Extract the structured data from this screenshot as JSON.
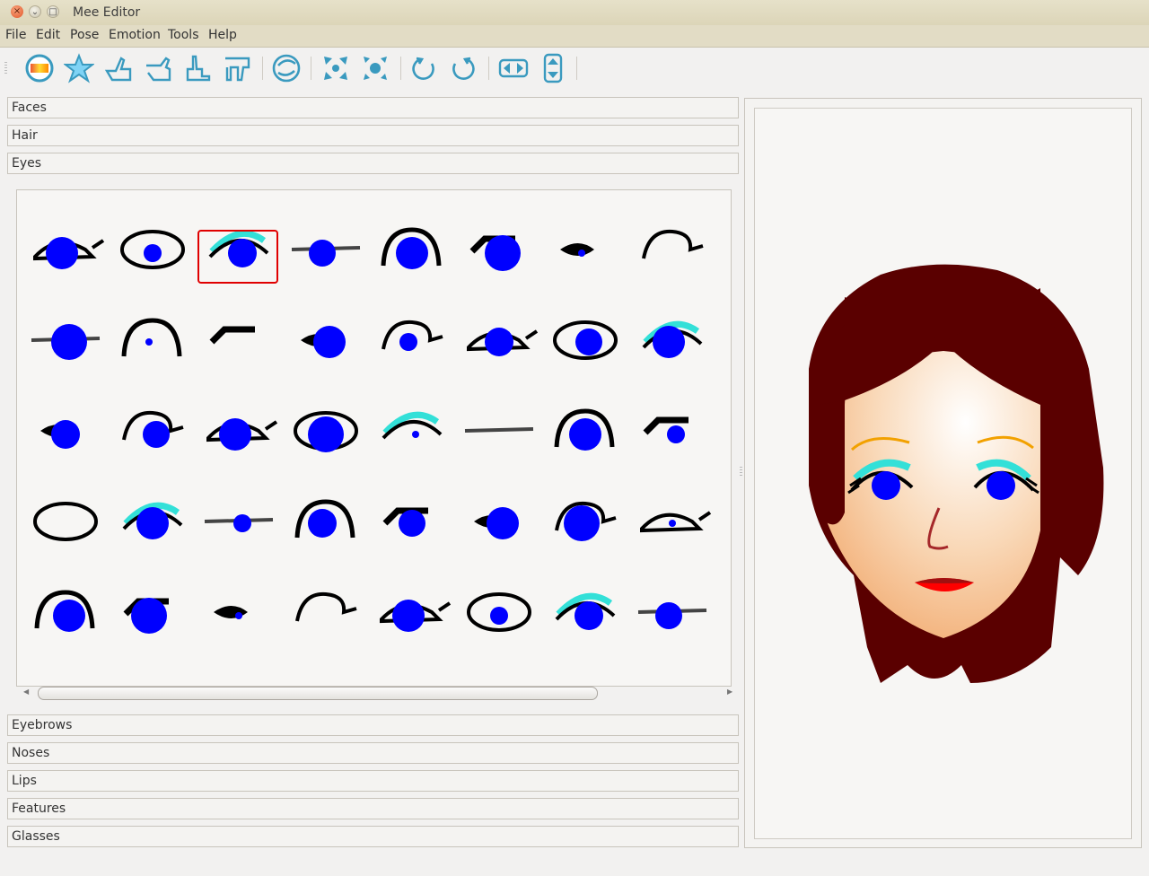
{
  "window": {
    "title": "Mee Editor",
    "close_glyph": "×",
    "min_glyph": "⌄",
    "max_glyph": "□"
  },
  "menu": [
    {
      "label": "File"
    },
    {
      "label": "Edit"
    },
    {
      "label": "Pose"
    },
    {
      "label": "Emotion"
    },
    {
      "label": "Tools"
    },
    {
      "label": "Help"
    }
  ],
  "toolbar": {
    "icons": [
      "color-palette-icon",
      "star-icon",
      "hand-point-up-icon",
      "hand-point-left-icon",
      "hand-victory-icon",
      "hand-point-down-icon",
      "face-outline-icon",
      "expand-icon",
      "shrink-icon",
      "rotate-ccw-icon",
      "rotate-cw-icon",
      "flip-horizontal-icon",
      "flip-vertical-icon"
    ]
  },
  "sections_top": [
    {
      "label": "Faces"
    },
    {
      "label": "Hair"
    },
    {
      "label": "Eyes"
    }
  ],
  "sections_bottom": [
    {
      "label": "Eyebrows"
    },
    {
      "label": "Noses"
    },
    {
      "label": "Lips"
    },
    {
      "label": "Features"
    },
    {
      "label": "Glasses"
    }
  ],
  "eyes_grid": {
    "rows": 5,
    "cols": 8,
    "selected_index": 2
  },
  "colors": {
    "iris": "#0000ff",
    "hair": "#5a0000",
    "skin": "#f6c18f",
    "lips": "#ff0000",
    "lash_accent": "#33e0d8",
    "brow": "#f2a100",
    "selection": "#e00000"
  }
}
